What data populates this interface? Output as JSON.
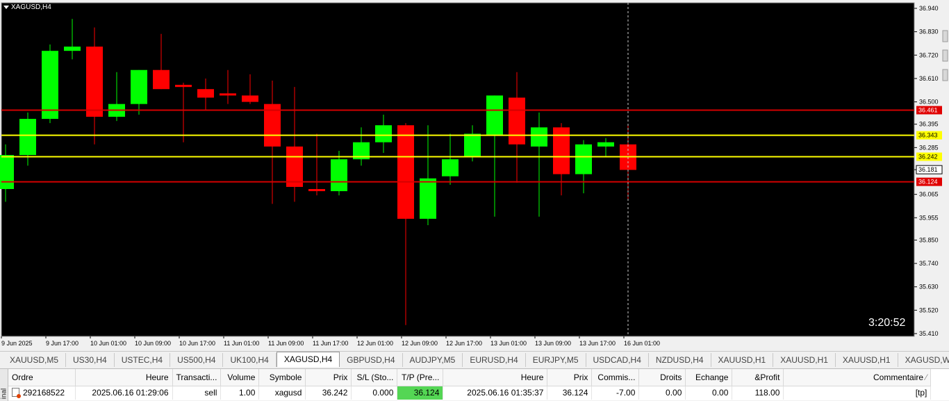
{
  "chart": {
    "title": "XAGUSD,H4",
    "countdown": "3:20:52",
    "colors": {
      "background": "#000000",
      "bull": "#00ff00",
      "bear": "#ff0000",
      "hline_red": "#d40000",
      "hline_yellow": "#ffff00",
      "axis_text": "#000000"
    }
  },
  "chart_data": {
    "type": "candlestick",
    "symbol": "XAGUSD",
    "timeframe": "H4",
    "ylim": [
      35.41,
      36.94
    ],
    "y_ticks": [
      "36.940",
      "36.830",
      "36.720",
      "36.610",
      "36.500",
      "36.395",
      "36.285",
      "36.181",
      "36.065",
      "35.955",
      "35.850",
      "35.740",
      "35.630",
      "35.520",
      "35.410"
    ],
    "x_ticks": [
      "9 Jun 2025",
      "9 Jun 17:00",
      "10 Jun 01:00",
      "10 Jun 09:00",
      "10 Jun 17:00",
      "11 Jun 01:00",
      "11 Jun 09:00",
      "11 Jun 17:00",
      "12 Jun 01:00",
      "12 Jun 09:00",
      "12 Jun 17:00",
      "13 Jun 01:00",
      "13 Jun 09:00",
      "13 Jun 17:00",
      "16 Jun 01:00"
    ],
    "candles": [
      {
        "o": 36.09,
        "h": 36.3,
        "l": 36.03,
        "c": 36.25
      },
      {
        "o": 36.25,
        "h": 36.45,
        "l": 36.2,
        "c": 36.42
      },
      {
        "o": 36.42,
        "h": 36.77,
        "l": 36.4,
        "c": 36.74
      },
      {
        "o": 36.74,
        "h": 36.89,
        "l": 36.7,
        "c": 36.76
      },
      {
        "o": 36.76,
        "h": 36.85,
        "l": 36.3,
        "c": 36.43
      },
      {
        "o": 36.43,
        "h": 36.64,
        "l": 36.41,
        "c": 36.49
      },
      {
        "o": 36.49,
        "h": 36.65,
        "l": 36.44,
        "c": 36.65
      },
      {
        "o": 36.65,
        "h": 36.82,
        "l": 36.56,
        "c": 36.56
      },
      {
        "o": 36.58,
        "h": 36.59,
        "l": 36.31,
        "c": 36.57
      },
      {
        "o": 36.56,
        "h": 36.61,
        "l": 36.46,
        "c": 36.52
      },
      {
        "o": 36.54,
        "h": 36.65,
        "l": 36.49,
        "c": 36.53
      },
      {
        "o": 36.53,
        "h": 36.63,
        "l": 36.49,
        "c": 36.5
      },
      {
        "o": 36.49,
        "h": 36.6,
        "l": 36.02,
        "c": 36.29
      },
      {
        "o": 36.29,
        "h": 36.57,
        "l": 36.03,
        "c": 36.1
      },
      {
        "o": 36.09,
        "h": 36.35,
        "l": 36.06,
        "c": 36.08
      },
      {
        "o": 36.08,
        "h": 36.27,
        "l": 36.06,
        "c": 36.23
      },
      {
        "o": 36.23,
        "h": 36.38,
        "l": 36.2,
        "c": 36.31
      },
      {
        "o": 36.31,
        "h": 36.44,
        "l": 36.26,
        "c": 36.39
      },
      {
        "o": 36.39,
        "h": 36.4,
        "l": 35.45,
        "c": 35.95
      },
      {
        "o": 35.95,
        "h": 36.39,
        "l": 35.92,
        "c": 36.14
      },
      {
        "o": 36.15,
        "h": 36.35,
        "l": 36.11,
        "c": 36.23
      },
      {
        "o": 36.24,
        "h": 36.39,
        "l": 36.22,
        "c": 36.35
      },
      {
        "o": 36.34,
        "h": 36.53,
        "l": 35.96,
        "c": 36.53
      },
      {
        "o": 36.52,
        "h": 36.64,
        "l": 36.12,
        "c": 36.3
      },
      {
        "o": 36.29,
        "h": 36.45,
        "l": 35.96,
        "c": 36.38
      },
      {
        "o": 36.38,
        "h": 36.4,
        "l": 36.06,
        "c": 36.16
      },
      {
        "o": 36.16,
        "h": 36.32,
        "l": 36.07,
        "c": 36.3
      },
      {
        "o": 36.29,
        "h": 36.33,
        "l": 36.24,
        "c": 36.31
      },
      {
        "o": 36.3,
        "h": 36.39,
        "l": 36.04,
        "c": 36.18
      }
    ],
    "hlines": [
      {
        "price": 36.461,
        "label": "36.461",
        "color": "#d40000"
      },
      {
        "price": 36.343,
        "label": "36.343",
        "color": "#ffff00"
      },
      {
        "price": 36.242,
        "label": "36.242",
        "color": "#ffff00"
      },
      {
        "price": 36.124,
        "label": "36.124",
        "color": "#d40000"
      }
    ],
    "current_price": "36.181",
    "vline_at": "16 Jun 01:00"
  },
  "tabs": [
    "XAUUSD,M5",
    "US30,H4",
    "USTEC,H4",
    "US500,H4",
    "UK100,H4",
    "XAGUSD,H4",
    "GBPUSD,H4",
    "AUDJPY,M5",
    "EURUSD,H4",
    "EURJPY,M5",
    "USDCAD,H4",
    "NZDUSD,H4",
    "XAUUSD,H1",
    "XAUUSD,H1",
    "XAUUSD,H1",
    "XAGUSD,Weekly"
  ],
  "active_tab_index": 5,
  "terminal": {
    "side_label": "inal",
    "columns": [
      "Ordre",
      "Heure",
      "Transacti...",
      "Volume",
      "Symbole",
      "Prix",
      "S/L (Sto...",
      "T/P (Pre...",
      "Heure",
      "Prix",
      "Commis...",
      "Droits",
      "Echange",
      "&Profit",
      "Commentaire"
    ],
    "row": {
      "ordre": "292168522",
      "heure_open": "2025.06.16 01:29:06",
      "transaction": "sell",
      "volume": "1.00",
      "symbole": "xagusd",
      "prix_open": "36.242",
      "sl": "0.000",
      "tp": "36.124",
      "heure_close": "2025.06.16 01:35:37",
      "prix_close": "36.124",
      "commission": "-7.00",
      "droits": "0.00",
      "echange": "0.00",
      "profit": "118.00",
      "commentaire": "[tp]"
    }
  }
}
